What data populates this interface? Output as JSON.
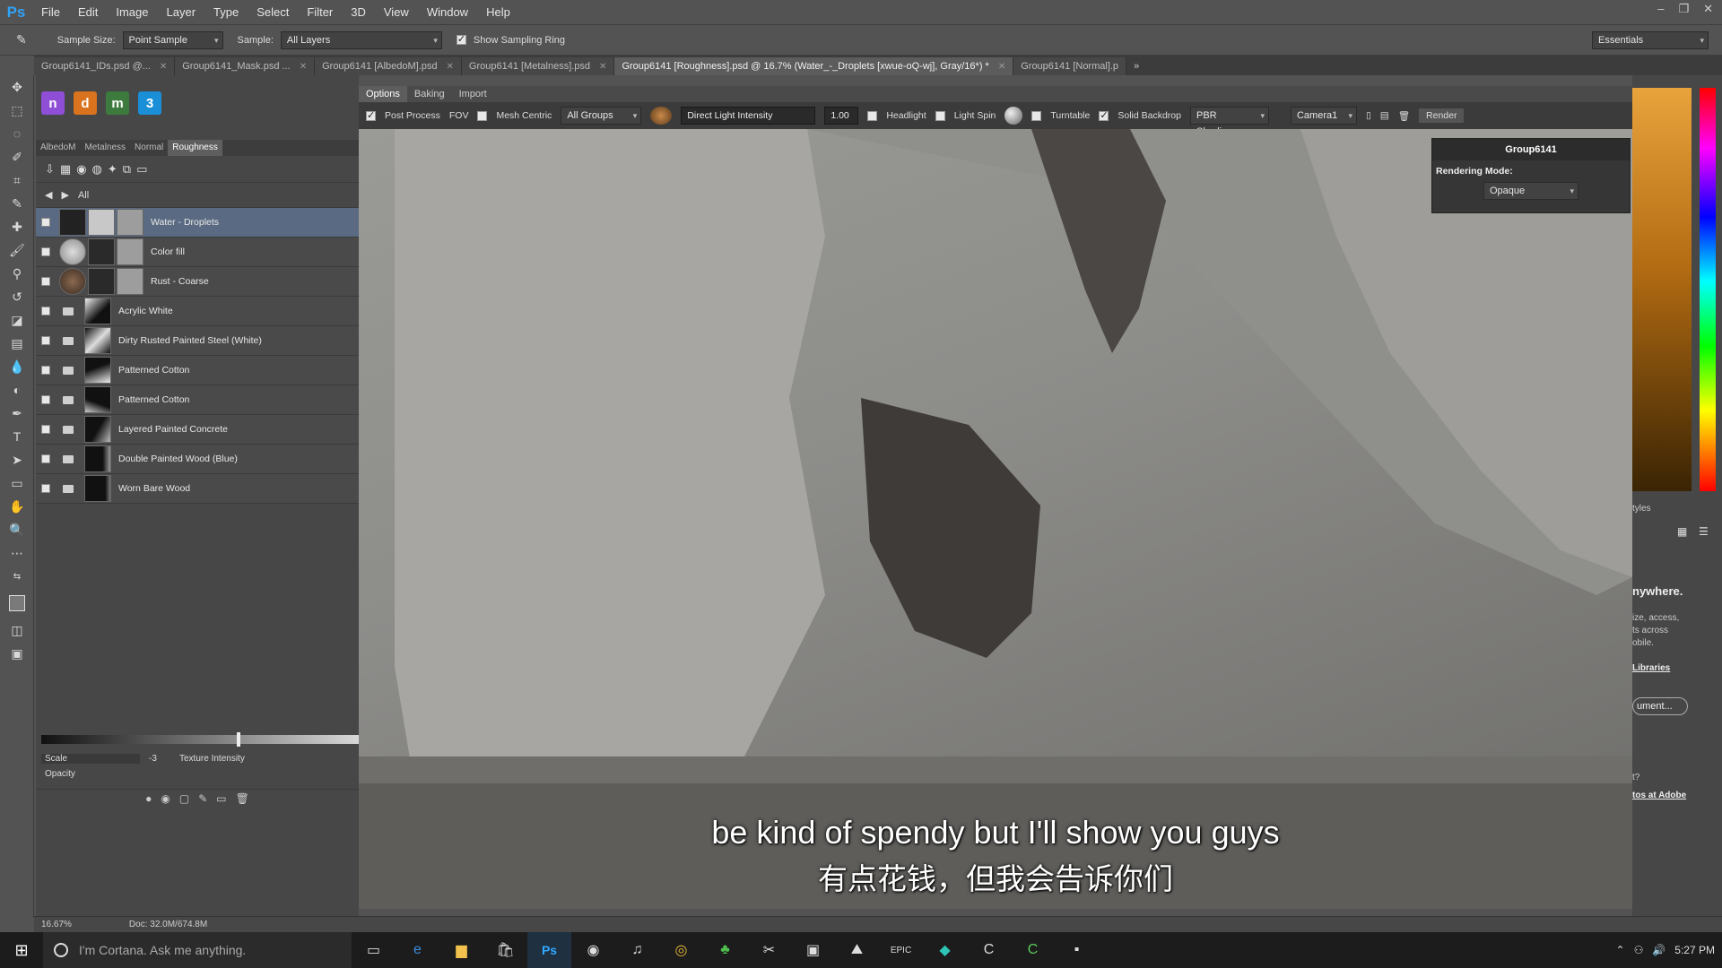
{
  "app": {
    "logo": "Ps"
  },
  "menu": [
    "File",
    "Edit",
    "Image",
    "Layer",
    "Type",
    "Select",
    "Filter",
    "3D",
    "View",
    "Window",
    "Help"
  ],
  "options": {
    "sample_size_label": "Sample Size:",
    "sample_size_value": "Point Sample",
    "sample_label": "Sample:",
    "sample_value": "All Layers",
    "show_ring_label": "Show Sampling Ring",
    "workspace": "Essentials"
  },
  "doc_tabs": [
    {
      "label": "Group6141_IDs.psd @..."
    },
    {
      "label": "Group6141_Mask.psd ..."
    },
    {
      "label": "Group6141 [AlbedoM].psd"
    },
    {
      "label": "Group6141 [Metalness].psd"
    },
    {
      "label": "Group6141 [Roughness].psd @ 16.7% (Water_-_Droplets [xwue-oQ-wj], Gray/16*) *"
    },
    {
      "label": "Group6141 [Normal].p"
    }
  ],
  "plugins": [
    {
      "label": "n",
      "color": "#8e4fd6"
    },
    {
      "label": "d",
      "color": "#d9731e"
    },
    {
      "label": "m",
      "color": "#3d7a3d"
    },
    {
      "label": "3",
      "color": "#1a8fd8"
    }
  ],
  "channels": [
    "AlbedoM",
    "Metalness",
    "Normal",
    "Roughness"
  ],
  "nav_label": "All",
  "layers": [
    {
      "name": "Water - Droplets",
      "selected": true
    },
    {
      "name": "Color fill"
    },
    {
      "name": "Rust - Coarse"
    },
    {
      "name": "Acrylic White"
    },
    {
      "name": "Dirty Rusted Painted Steel (White)"
    },
    {
      "name": "Patterned Cotton"
    },
    {
      "name": "Patterned Cotton"
    },
    {
      "name": "Layered Painted Concrete"
    },
    {
      "name": "Double Painted Wood (Blue)"
    },
    {
      "name": "Worn Bare Wood"
    }
  ],
  "layer_controls": {
    "scale_label": "Scale",
    "scale_value": "-3",
    "intensity_label": "Texture Intensity",
    "opacity_label": "Opacity"
  },
  "viewport": {
    "tabs": [
      "Options",
      "Baking",
      "Import"
    ],
    "post_process": "Post Process",
    "fov": "FOV",
    "mesh_centric": "Mesh Centric",
    "groups": "All Groups",
    "light_label": "Direct Light Intensity",
    "light_value": "1.00",
    "headlight": "Headlight",
    "light_spin": "Light Spin",
    "turntable": "Turntable",
    "solid_backdrop": "Solid Backdrop",
    "shading": "PBR Shading",
    "camera": "Camera1",
    "render": "Render",
    "props_title": "Group6141",
    "rendering_mode_label": "Rendering Mode:",
    "rendering_mode_value": "Opaque"
  },
  "subtitles": {
    "en": "be kind of spendy but I'll show you guys",
    "zh": "有点花钱，但我会告诉你们"
  },
  "right_panel": {
    "styles_label": "tyles",
    "promo_title": "nywhere.",
    "promo_line1": "ize, access,",
    "promo_line2": "ts across",
    "promo_line3": "obile.",
    "promo_link": "Libraries",
    "doc_button": "ument...",
    "bottom_text": "t?",
    "bottom_link": "tos at Adobe"
  },
  "status": {
    "zoom": "16.67%",
    "doc": "Doc: 32.0M/674.8M"
  },
  "taskbar": {
    "cortana_placeholder": "I'm Cortana. Ask me anything.",
    "ps_label": "Ps",
    "tray_time": "5:27 PM"
  }
}
